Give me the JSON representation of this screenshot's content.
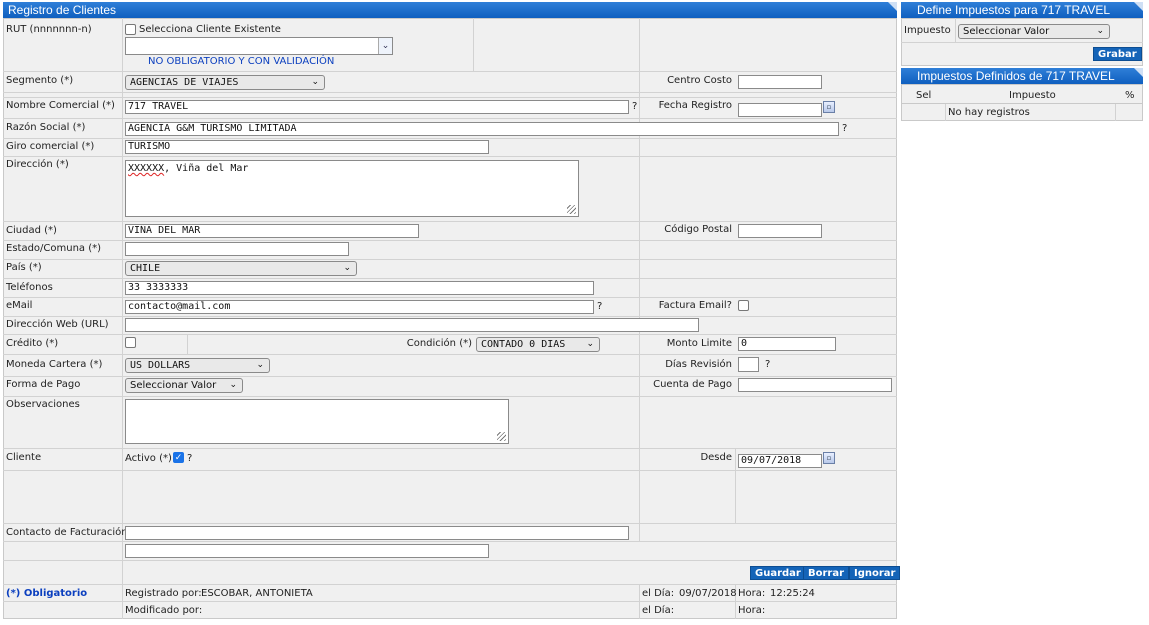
{
  "form": {
    "title": "Registro de Clientes",
    "rut": {
      "label": "RUT (nnnnnnn-n)",
      "checkbox_label": "Selecciona Cliente Existente",
      "value": "",
      "hint": "NO OBLIGATORIO Y CON VALIDACIÓN"
    },
    "segmento": {
      "label": "Segmento (*)",
      "value": "AGENCIAS DE VIAJES"
    },
    "centro_costo": {
      "label": "Centro Costo",
      "value": ""
    },
    "nombre_comercial": {
      "label": "Nombre Comercial (*)",
      "value": "717 TRAVEL"
    },
    "fecha_registro": {
      "label": "Fecha Registro",
      "value": ""
    },
    "razon_social": {
      "label": "Razón Social (*)",
      "value": "AGENCIA G&M TURISMO LIMITADA"
    },
    "giro": {
      "label": "Giro comercial (*)",
      "value": "TURISMO"
    },
    "direccion": {
      "label": "Dirección (*)",
      "value_underlined": "XXXXXX",
      "value_rest": ", Viña del Mar"
    },
    "ciudad": {
      "label": "Ciudad (*)",
      "value": "VIÑA DEL MAR"
    },
    "codigo_postal": {
      "label": "Código Postal",
      "value": ""
    },
    "estado": {
      "label": "Estado/Comuna (*)",
      "value": ""
    },
    "pais": {
      "label": "País (*)",
      "value": "CHILE"
    },
    "telefonos": {
      "label": "Teléfonos",
      "value": "33 3333333"
    },
    "email": {
      "label": "eMail",
      "value": "contacto@mail.com"
    },
    "factura_email": {
      "label": "Factura Email?"
    },
    "web": {
      "label": "Dirección Web (URL)",
      "value": ""
    },
    "credito": {
      "label": "Crédito (*)"
    },
    "condicion": {
      "label": "Condición (*)",
      "value": "CONTADO 0 DIAS"
    },
    "monto_limite": {
      "label": "Monto Limite",
      "value": "0"
    },
    "moneda": {
      "label": "Moneda Cartera (*)",
      "value": "US DOLLARS"
    },
    "dias_revision": {
      "label": "Días Revisión",
      "value": ""
    },
    "forma_pago": {
      "label": "Forma de Pago",
      "value": "Seleccionar Valor"
    },
    "cuenta_pago": {
      "label": "Cuenta de Pago",
      "value": ""
    },
    "observaciones": {
      "label": "Observaciones",
      "value": ""
    },
    "cliente": {
      "label": "Cliente",
      "activo_label": "Activo (*)"
    },
    "desde": {
      "label": "Desde",
      "value": "09/07/2018"
    },
    "contacto": {
      "label": "Contacto de Facturación",
      "value1": "",
      "value2": ""
    },
    "q": "?",
    "cal_icon": "▫",
    "buttons": {
      "guardar": "Guardar",
      "borrar": "Borrar",
      "ignorar": "Ignorar"
    },
    "footer": {
      "obligatorio": "(*) Obligatorio",
      "registrado_label": "Registrado por:",
      "registrado_value": "ESCOBAR, ANTONIETA",
      "el_dia_label": "el Día:",
      "el_dia_value": "09/07/2018",
      "hora_label": "Hora:",
      "hora_value": "12:25:24",
      "modificado_label": "Modificado por:"
    }
  },
  "impuestos": {
    "title": "Define Impuestos para 717 TRAVEL",
    "impuesto_label": "Impuesto",
    "select_value": "Seleccionar Valor",
    "grabar": "Grabar",
    "definidos_title": "Impuestos Definidos de 717 TRAVEL",
    "columns": [
      "Sel",
      "Impuesto",
      "%"
    ],
    "empty": "No hay registros"
  },
  "colors": {
    "header": "#1464b8",
    "panel": "#f0f0f0",
    "hint": "#0b3fbf"
  }
}
